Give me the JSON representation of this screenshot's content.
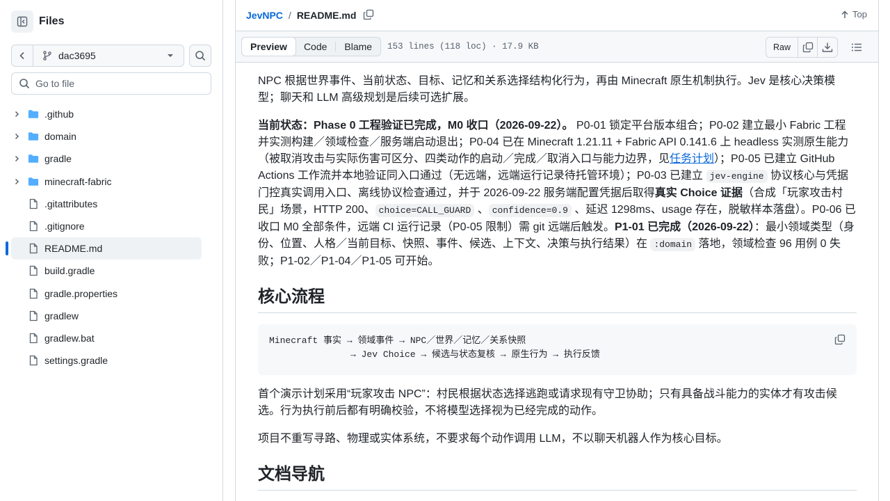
{
  "sidebar": {
    "title": "Files",
    "branch": "dac3695",
    "goto_placeholder": "Go to file",
    "items": [
      {
        "type": "folder",
        "name": ".github"
      },
      {
        "type": "folder",
        "name": "domain"
      },
      {
        "type": "folder",
        "name": "gradle"
      },
      {
        "type": "folder",
        "name": "minecraft-fabric"
      },
      {
        "type": "file",
        "name": ".gitattributes"
      },
      {
        "type": "file",
        "name": ".gitignore"
      },
      {
        "type": "file",
        "name": "README.md",
        "selected": true
      },
      {
        "type": "file",
        "name": "build.gradle"
      },
      {
        "type": "file",
        "name": "gradle.properties"
      },
      {
        "type": "file",
        "name": "gradlew"
      },
      {
        "type": "file",
        "name": "gradlew.bat"
      },
      {
        "type": "file",
        "name": "settings.gradle"
      }
    ]
  },
  "header": {
    "repo": "JevNPC",
    "separator": "/",
    "file": "README.md",
    "top_label": "Top"
  },
  "toolbar": {
    "tabs": [
      "Preview",
      "Code",
      "Blame"
    ],
    "active_tab": "Preview",
    "meta": "153 lines (118 loc) · 17.9 KB",
    "raw_label": "Raw"
  },
  "content": {
    "p1": "NPC 根据世界事件、当前状态、目标、记忆和关系选择结构化行为，再由 Minecraft 原生机制执行。Jev 是核心决策模型；聊天和 LLM 高级规划是后续可选扩展。",
    "p2": {
      "s1_bold": "当前状态：Phase 0 工程验证已完成，M0 收口（2026-09-22）。",
      "s2": " P0-01 锁定平台版本组合；P0-02 建立最小 Fabric 工程并实测构建／领域检查／服务端启动退出；P0-04 已在 Minecraft 1.21.11 + Fabric API 0.141.6 上 headless 实测原生能力（被取消攻击与实际伤害可区分、四类动作的启动／完成／取消入口与能力边界，见",
      "link": "任务计划",
      "s3": "）；P0-05 已建立 GitHub Actions 工作流并本地验证同入口通过（无远端，远端运行记录待托管环境）；P0-03 已建立 ",
      "code1": "jev-engine",
      "s4": " 协议核心与凭据门控真实调用入口、离线协议检查通过，并于 2026-09-22 服务端配置凭据后取得",
      "s5_bold": "真实 Choice 证据",
      "s6": "（合成「玩家攻击村民」场景，HTTP 200、",
      "code2": "choice=CALL_GUARD",
      "s7": " 、",
      "code3": "confidence=0.9",
      "s8": " 、延迟 1298ms、usage 存在，脱敏样本落盘）。P0-06 已收口 M0 全部条件，远端 CI 运行记录（P0-05 限制）需 git 远端后触发。",
      "s9_bold": "P1-01 已完成（2026-09-22）",
      "s10": "：最小领域类型（身份、位置、人格／当前目标、快照、事件、候选、上下文、决策与执行结果）在 ",
      "code4": ":domain",
      "s11": " 落地，领域检查 96 用例 0 失败；P1-02／P1-04／P1-05 可开始。"
    },
    "h2_flow": "核心流程",
    "code_line1": "Minecraft 事实 → 领域事件 → NPC／世界／记忆／关系快照",
    "code_line2": "               → Jev Choice → 候选与状态复核 → 原生行为 → 执行反馈",
    "p3": "首个演示计划采用“玩家攻击 NPC”：村民根据状态选择逃跑或请求现有守卫协助；只有具备战斗能力的实体才有攻击候选。行为执行前后都有明确校验，不将模型选择视为已经完成的动作。",
    "p4": "项目不重写寻路、物理或实体系统，不要求每个动作调用 LLM，不以聊天机器人作为核心目标。",
    "h2_docs": "文档导航"
  },
  "colors": {
    "accent": "#0969da",
    "folder": "#54aeff",
    "muted": "#59636e",
    "border": "#d1d9e0"
  }
}
